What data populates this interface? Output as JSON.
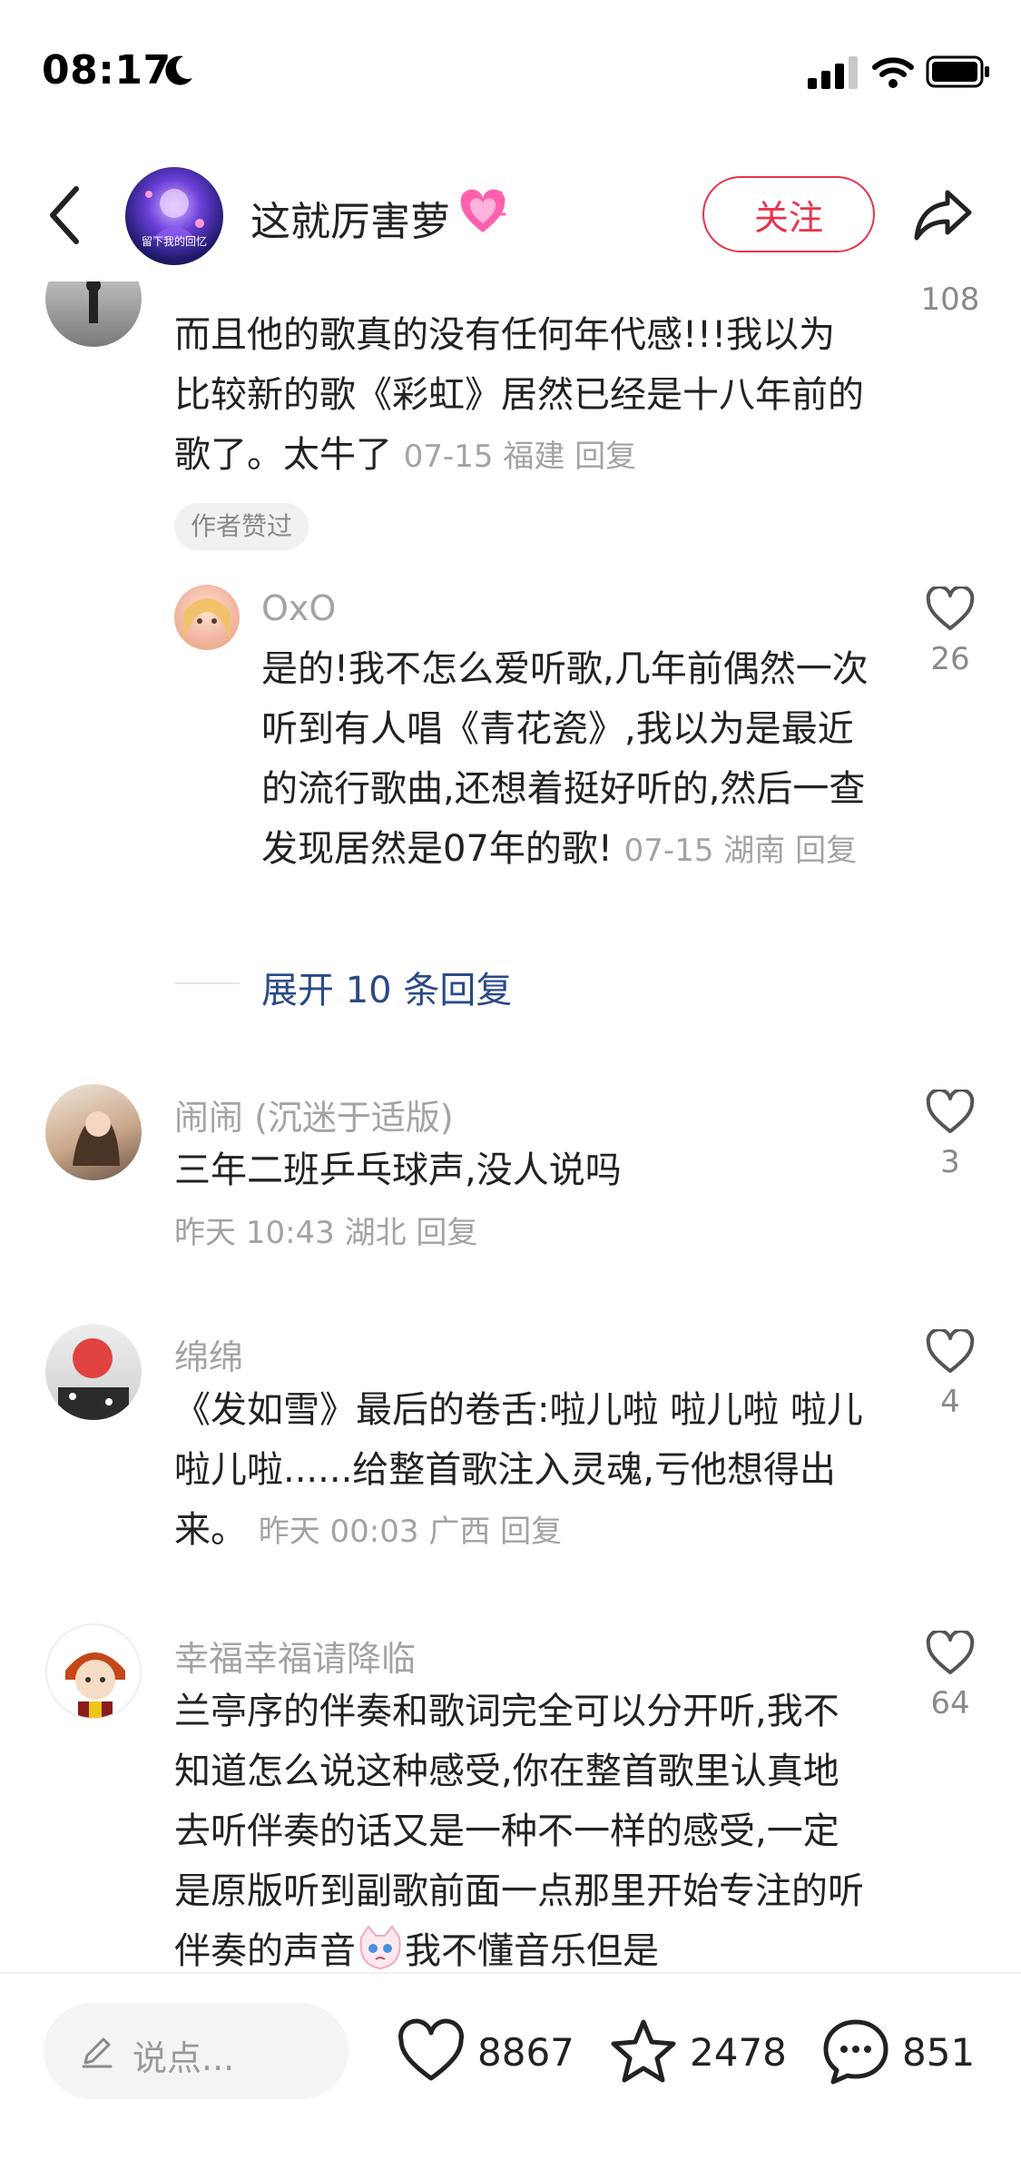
{
  "status_bar": {
    "time": "08:17"
  },
  "header": {
    "avatar_caption": "留下我的回忆",
    "author_name": "这就厉害萝",
    "follow_label": "关注"
  },
  "comments": [
    {
      "text": "而且他的歌真的没有任何年代感!!!我以为比较新的歌《彩虹》居然已经是十八年前的歌了。太牛了",
      "meta": "07-15 福建 回复",
      "badge": "作者赞过",
      "likes": "108"
    },
    {
      "name": "OxO",
      "text": "是的!我不怎么爱听歌,几年前偶然一次听到有人唱《青花瓷》,我以为是最近的流行歌曲,还想着挺好听的,然后一查发现居然是07年的歌!",
      "meta": "07-15 湖南 回复",
      "likes": "26"
    },
    {
      "expand_label": "展开 10 条回复"
    },
    {
      "name": "闹闹 (沉迷于适版)",
      "text": "三年二班乒乓球声,没人说吗",
      "meta": "昨天 10:43 湖北 回复",
      "likes": "3"
    },
    {
      "name": "绵绵",
      "text": "《发如雪》最后的卷舌:啦儿啦 啦儿啦 啦儿啦儿啦......给整首歌注入灵魂,亏他想得出来。",
      "meta": "昨天 00:03 广西 回复",
      "likes": "4"
    },
    {
      "name": "幸福幸福请降临",
      "text_part1": "兰亭序的伴奏和歌词完全可以分开听,我不知道怎么说这种感受,你在整首歌里认真地去听伴奏的话又是一种不一样的感受,一定是原版听到副歌前面一点那里开始专注的听伴奏的声音",
      "text_part2": "我不懂音乐但是",
      "likes": "64"
    }
  ],
  "bottom_bar": {
    "placeholder": "说点...",
    "like_count": "8867",
    "collect_count": "2478",
    "comment_count": "851"
  },
  "icons": {
    "back": "back-arrow-icon",
    "share": "share-icon",
    "heart_outline": "heart-outline-icon",
    "star_outline": "star-outline-icon",
    "chat_bubble": "chat-bubble-icon",
    "pencil": "pencil-icon"
  },
  "colors": {
    "follow_red": "#e8334a",
    "link_blue": "#2a4a87",
    "meta_grey": "#a3a3a3"
  }
}
